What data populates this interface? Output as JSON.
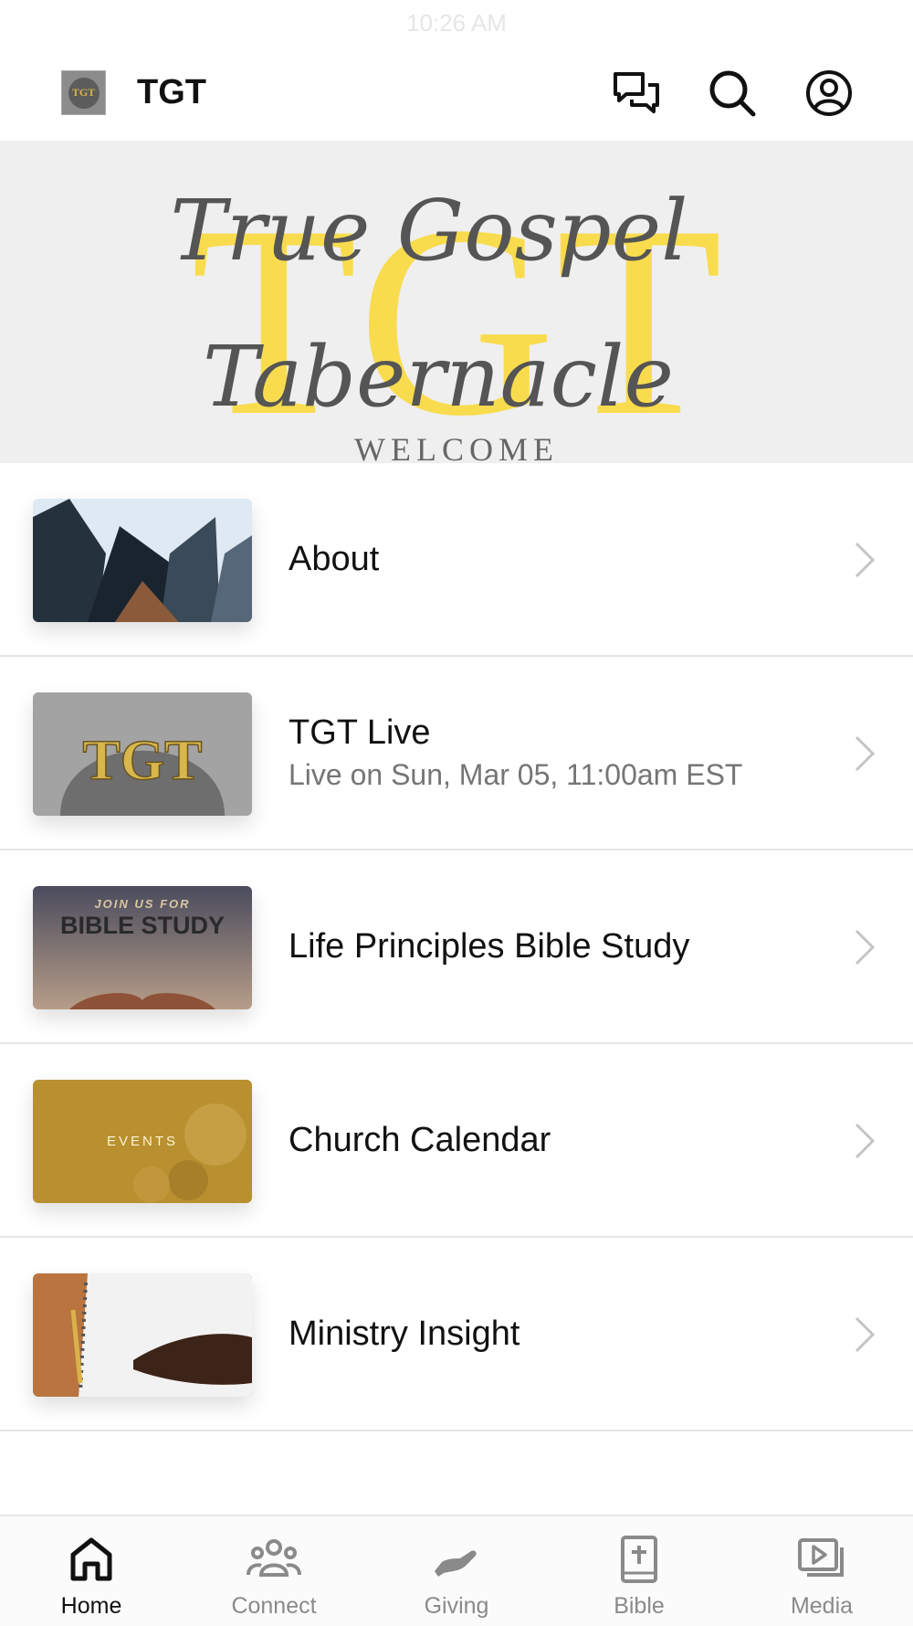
{
  "status_bar": {
    "time": "10:26 AM"
  },
  "header": {
    "title": "TGT",
    "logo_text": "TGT"
  },
  "banner": {
    "line1": "True Gospel",
    "line2": "Tabernacle",
    "letters": "TGT",
    "caption": "WELCOME"
  },
  "thumb_texts": {
    "bible_top": "JOIN US FOR",
    "bible_main": "BIBLE STUDY",
    "events": "EVENTS",
    "live_logo": "TGT"
  },
  "items": [
    {
      "title": "About",
      "subtitle": ""
    },
    {
      "title": "TGT Live",
      "subtitle": "Live on Sun, Mar 05, 11:00am EST"
    },
    {
      "title": "Life Principles Bible Study",
      "subtitle": ""
    },
    {
      "title": "Church Calendar",
      "subtitle": ""
    },
    {
      "title": "Ministry Insight",
      "subtitle": ""
    }
  ],
  "tabs": [
    {
      "label": "Home",
      "icon": "home-icon",
      "active": true
    },
    {
      "label": "Connect",
      "icon": "people-icon",
      "active": false
    },
    {
      "label": "Giving",
      "icon": "giving-hand-icon",
      "active": false
    },
    {
      "label": "Bible",
      "icon": "bible-icon",
      "active": false
    },
    {
      "label": "Media",
      "icon": "media-play-icon",
      "active": false
    }
  ],
  "colors": {
    "accent_yellow": "#f8dc4e",
    "active_tab": "#111111",
    "inactive_tab": "#8a8a8a"
  }
}
